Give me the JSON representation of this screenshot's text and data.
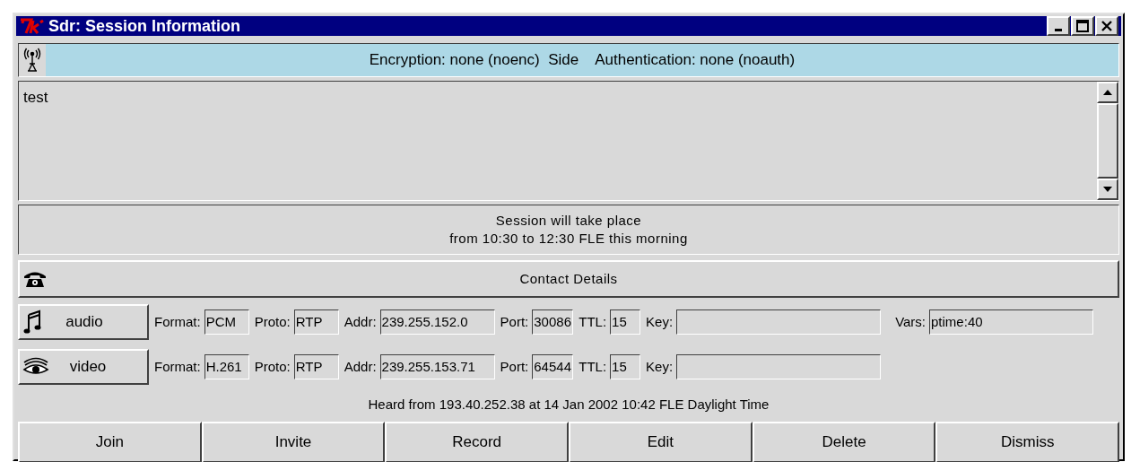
{
  "window": {
    "title": "Sdr: Session Information"
  },
  "security": {
    "text": "Encryption: none (noenc)  Side    Authentication: none (noauth)"
  },
  "description": {
    "text": "test"
  },
  "schedule": {
    "lines": [
      "Session will take place",
      "from 10:30 to 12:30 FLE this morning"
    ]
  },
  "contact": {
    "label": "Contact Details"
  },
  "media": [
    {
      "kind": "audio",
      "label": "audio",
      "fields": [
        {
          "label": "Format:",
          "value": "PCM"
        },
        {
          "label": "Proto:",
          "value": "RTP"
        },
        {
          "label": "Addr:",
          "value": "239.255.152.0"
        },
        {
          "label": "Port:",
          "value": "30086"
        },
        {
          "label": "TTL:",
          "value": "15"
        },
        {
          "label": "Key:"
        },
        {
          "label": "Vars:",
          "value": "ptime:40"
        }
      ]
    },
    {
      "kind": "video",
      "label": "video",
      "fields": [
        {
          "label": "Format:",
          "value": "H.261"
        },
        {
          "label": "Proto:",
          "value": "RTP"
        },
        {
          "label": "Addr:",
          "value": "239.255.153.71"
        },
        {
          "label": "Port:",
          "value": "64544"
        },
        {
          "label": "TTL:",
          "value": "15"
        },
        {
          "label": "Key:"
        }
      ]
    }
  ],
  "heard": {
    "text": "Heard from 193.40.252.38 at 14 Jan 2002 10:42 FLE Daylight Time"
  },
  "buttons": [
    "Join",
    "Invite",
    "Record",
    "Edit",
    "Delete",
    "Dismiss"
  ]
}
